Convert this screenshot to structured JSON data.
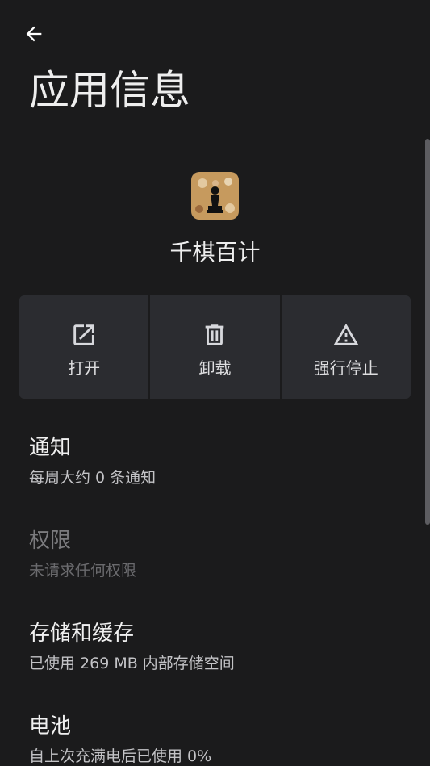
{
  "header": {
    "title": "应用信息"
  },
  "app": {
    "name": "千棋百计"
  },
  "actions": [
    {
      "label": "打开"
    },
    {
      "label": "卸载"
    },
    {
      "label": "强行停止"
    }
  ],
  "settings": [
    {
      "title": "通知",
      "subtitle": "每周大约 0 条通知"
    },
    {
      "title": "权限",
      "subtitle": "未请求任何权限"
    },
    {
      "title": "存储和缓存",
      "subtitle": "已使用 269 MB 内部存储空间"
    },
    {
      "title": "电池",
      "subtitle": "自上次充满电后已使用 0%"
    }
  ]
}
